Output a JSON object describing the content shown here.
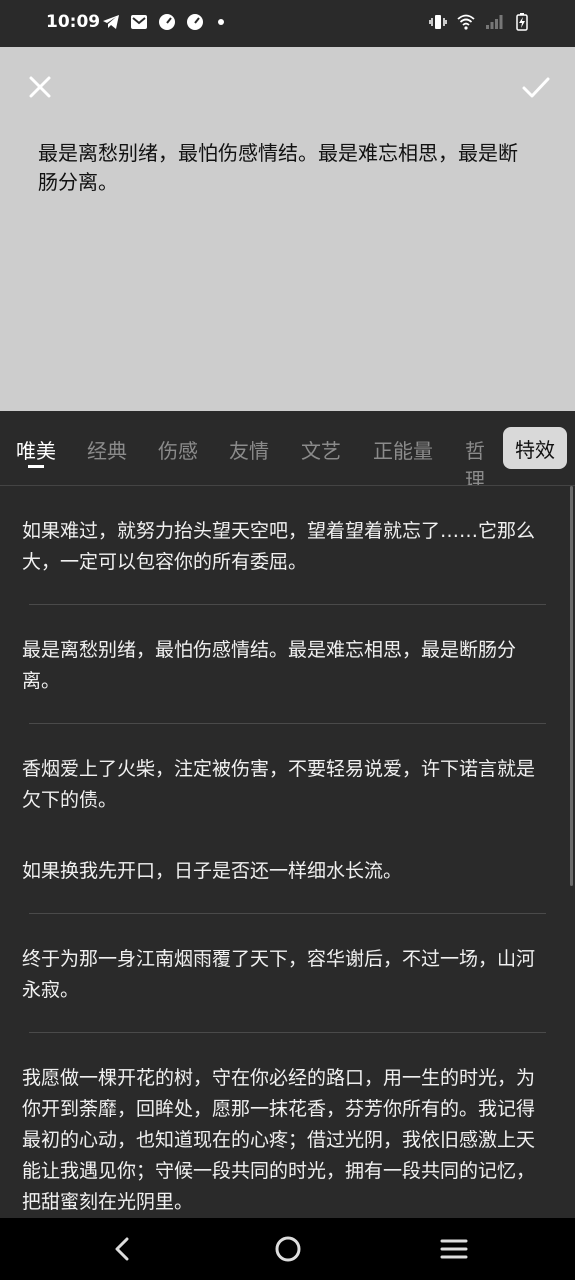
{
  "status": {
    "time": "10:09"
  },
  "preview": {
    "text": "最是离愁别绪，最怕伤感情结。最是难忘相思，最是断肠分离。"
  },
  "tabs": [
    {
      "label": "唯美",
      "active": true
    },
    {
      "label": "经典",
      "active": false
    },
    {
      "label": "伤感",
      "active": false
    },
    {
      "label": "友情",
      "active": false
    },
    {
      "label": "文艺",
      "active": false
    },
    {
      "label": "正能量",
      "active": false
    },
    {
      "label": "哲理",
      "active": false
    }
  ],
  "effect_button": "特效",
  "items": [
    "如果难过，就努力抬头望天空吧，望着望着就忘了……它那么大，一定可以包容你的所有委屈。",
    "最是离愁别绪，最怕伤感情结。最是难忘相思，最是断肠分离。",
    "香烟爱上了火柴，注定被伤害，不要轻易说爱，许下诺言就是欠下的债。",
    "如果换我先开口，日子是否还一样细水长流。",
    "终于为那一身江南烟雨覆了天下，容华谢后，不过一场，山河永寂。",
    "我愿做一棵开花的树，守在你必经的路口，用一生的时光，为你开到荼靡，回眸处，愿那一抹花香，芬芳你所有的。我记得最初的心动，也知道现在的心疼；借过光阴，我依旧感激上天能让我遇见你；守候一段共同的时光，拥有一段共同的记忆，把甜蜜刻在光阴里。"
  ],
  "colors": {
    "background": "#2a2a2a",
    "preview_bg": "#cdcdcd",
    "tab_active": "#ffffff",
    "tab_inactive": "#8b8b8b"
  }
}
